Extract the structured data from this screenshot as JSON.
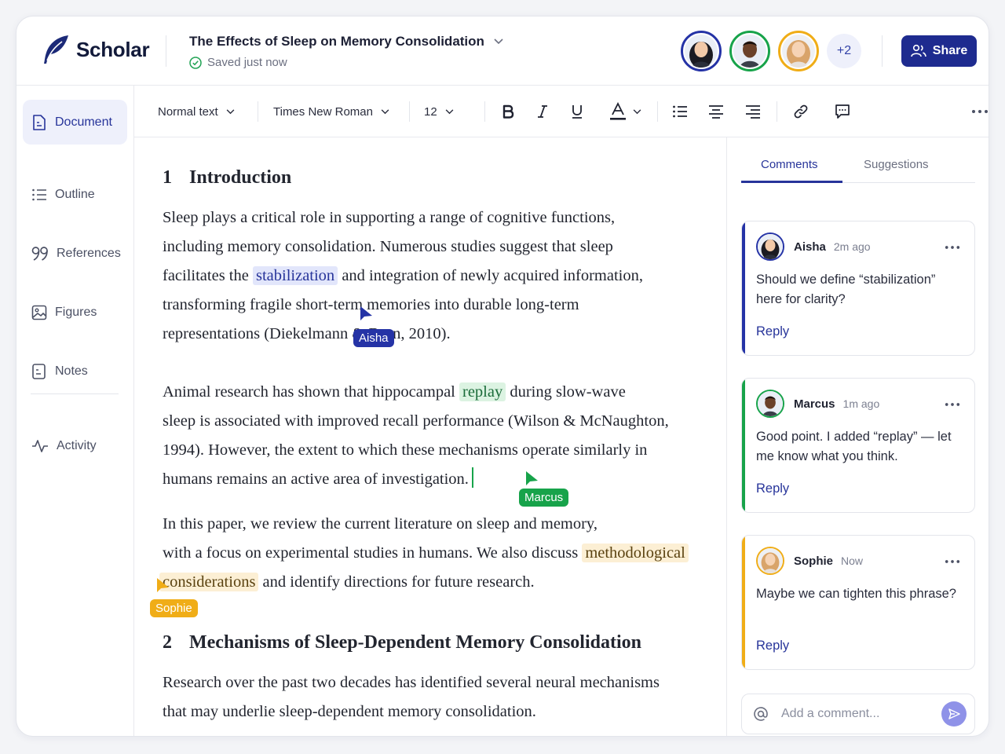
{
  "app": {
    "name": "Scholar"
  },
  "document": {
    "title": "The Effects of Sleep on Memory Consolidation",
    "save_status": "Saved just now"
  },
  "collaborators": {
    "more_count": "+2"
  },
  "header": {
    "share_label": "Share"
  },
  "sidebar": {
    "items": [
      {
        "label": "Document",
        "icon": "document-icon",
        "active": true
      },
      {
        "label": "Outline",
        "icon": "list-icon"
      },
      {
        "label": "References",
        "icon": "quote-icon"
      },
      {
        "label": "Figures",
        "icon": "image-icon"
      },
      {
        "label": "Notes",
        "icon": "note-icon"
      },
      {
        "label": "Activity",
        "icon": "activity-icon"
      }
    ]
  },
  "toolbar": {
    "style": "Normal text",
    "font": "Times New Roman",
    "size": "12",
    "text_color": "#1f2230"
  },
  "content": {
    "section1": {
      "number": "1",
      "title": "Introduction"
    },
    "p1": {
      "a": "Sleep plays a critical role in supporting a range of cognitive functions,",
      "b": "including memory consolidation.  Numerous studies suggest that sleep",
      "c": "facilitates the",
      "hl": "stabilization",
      "d": "and integration of newly acquired information,",
      "e": "transforming fragile short-term memories into durable long-term",
      "f": "representations (Diekelmann & Born, 2010)."
    },
    "p2": {
      "a": "Animal research has shown that hippocampal",
      "hl": "replay",
      "b": "during slow-wave",
      "c": "sleep is associated with improved recall performance (Wilson & McNaughton,",
      "d": "1994). However, the extent to which these mechanisms operate similarly in",
      "e": "humans remains an active area of investigation."
    },
    "p3": {
      "a": "In this paper, we review the current literature on sleep and memory,",
      "b": "with a focus on experimental studies in humans. We also discuss",
      "hl1": "methodological",
      "hl2": "considerations",
      "c": "and identify directions for future research."
    },
    "section2": {
      "number": "2",
      "title": "Mechanisms of Sleep-Dependent Memory Consolidation"
    },
    "p4": {
      "a": "Research over the past two decades has identified several neural mechanisms",
      "b": "that may underlie sleep-dependent memory consolidation."
    }
  },
  "cursors": {
    "aisha": {
      "name": "Aisha",
      "color": "#2533a6"
    },
    "marcus": {
      "name": "Marcus",
      "color": "#17a34a"
    },
    "sophie": {
      "name": "Sophie",
      "color": "#f0ad17"
    }
  },
  "comments_panel": {
    "tabs": [
      "Comments",
      "Suggestions"
    ],
    "active_tab": "Comments",
    "comments": [
      {
        "author": "Aisha",
        "time": "2m ago",
        "text": "Should we define “stabilization” here for clarity?",
        "reply_label": "Reply",
        "color": "#2533a6"
      },
      {
        "author": "Marcus",
        "time": "1m ago",
        "text": "Good point. I added “replay” — let me know what you think.",
        "reply_label": "Reply",
        "color": "#17a34a"
      },
      {
        "author": "Sophie",
        "time": "Now",
        "text": "Maybe we can tighten this phrase?",
        "reply_label": "Reply",
        "color": "#f0ad17"
      }
    ],
    "add_placeholder": "Add a comment..."
  }
}
